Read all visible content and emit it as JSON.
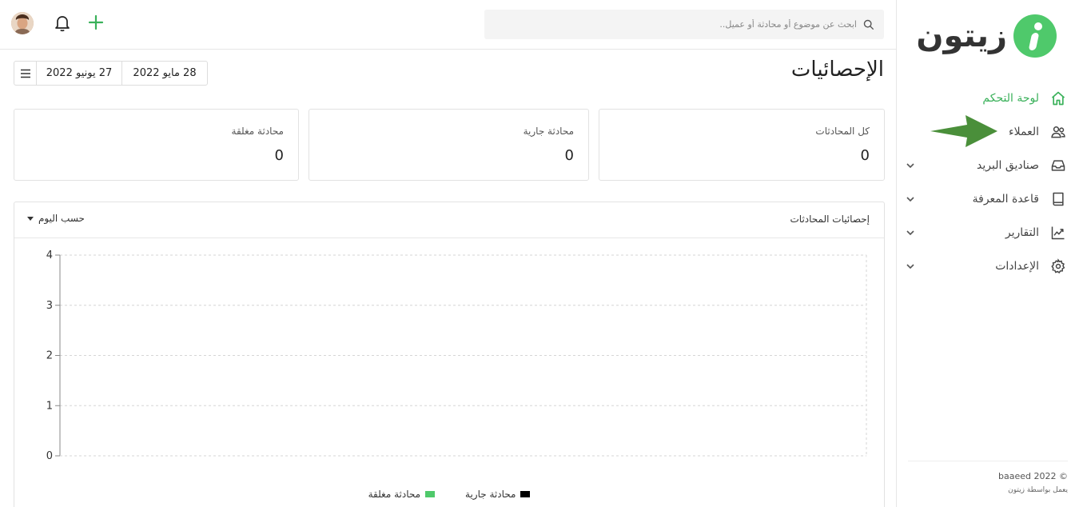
{
  "brand": {
    "logo_text": "زيتون",
    "accent": "#3ab15a"
  },
  "sidebar": {
    "items": [
      {
        "label": "لوحة التحكم",
        "icon": "home-icon",
        "active": true
      },
      {
        "label": "العملاء",
        "icon": "users-icon"
      },
      {
        "label": "صناديق البريد",
        "icon": "inbox-icon",
        "expandable": true
      },
      {
        "label": "قاعدة المعرفة",
        "icon": "book-icon",
        "expandable": true
      },
      {
        "label": "التقارير",
        "icon": "chart-line-icon",
        "expandable": true
      },
      {
        "label": "الإعدادات",
        "icon": "gear-icon",
        "expandable": true
      }
    ],
    "footer": {
      "copyright": "baaeed 2022 ©",
      "powered_by": "يعمل بواسطة زيتون"
    }
  },
  "topbar": {
    "search_placeholder": "ابحث عن موضوع أو محادثة أو عميل..",
    "icons": [
      "search-icon",
      "bell-icon",
      "plus-icon",
      "avatar"
    ]
  },
  "page": {
    "title": "الإحصائيات",
    "date_range": {
      "from": "28 مايو 2022",
      "to": "27 يونيو 2022"
    }
  },
  "stats": [
    {
      "title": "كل المحادثات",
      "value": "0"
    },
    {
      "title": "محادثة جارية",
      "value": "0"
    },
    {
      "title": "محادثة مغلقة",
      "value": "0"
    }
  ],
  "panel": {
    "title": "إحصائيات المحادثات",
    "filter": "حسب اليوم"
  },
  "chart_data": {
    "type": "line",
    "ylim": [
      0,
      4
    ],
    "y_ticks": [
      "0",
      "1",
      "2",
      "3",
      "4"
    ],
    "grid": true,
    "series": [
      {
        "name": "محادثة جارية",
        "color": "#000000",
        "values": []
      },
      {
        "name": "محادثة مغلقة",
        "color": "#4fc96b",
        "values": []
      }
    ],
    "legend": "bottom"
  }
}
